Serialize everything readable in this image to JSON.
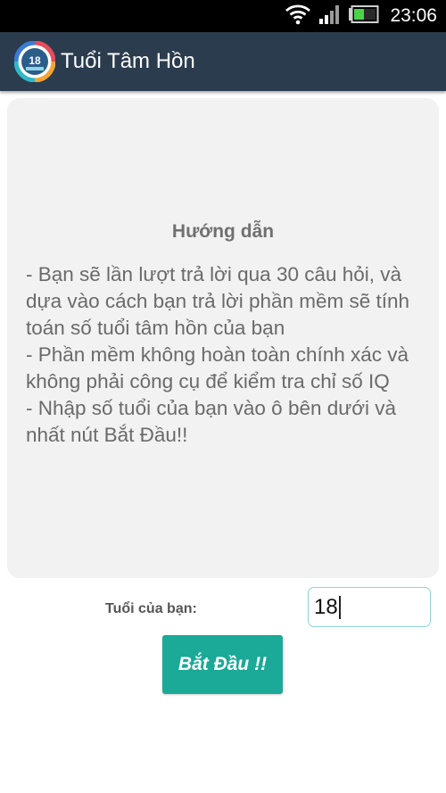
{
  "status_bar": {
    "time": "23:06",
    "icons": [
      "wifi-icon",
      "signal-icon",
      "battery-icon"
    ],
    "battery_level": 0.25
  },
  "action_bar": {
    "title": "Tuổi Tâm Hồn",
    "logo_icon": "app-logo-icon",
    "logo_text": "18",
    "background": "#2b3c4e"
  },
  "guide": {
    "title": "Hướng dẫn",
    "body": "- Bạn sẽ lần lượt trả lời qua 30 câu hỏi, và dựa vào cách bạn trả lời phần mềm sẽ tính toán số tuổi tâm hồn của bạn\n- Phần mềm không hoàn toàn chính xác và không phải công cụ để kiểm tra chỉ số IQ\n- Nhập số tuổi của bạn vào ô bên dưới và nhất nút Bắt Đầu!!"
  },
  "form": {
    "age_label": "Tuổi của bạn:",
    "age_value": "18",
    "start_button_label": "Bắt Đầu !!",
    "accent_color": "#1aaa97"
  }
}
